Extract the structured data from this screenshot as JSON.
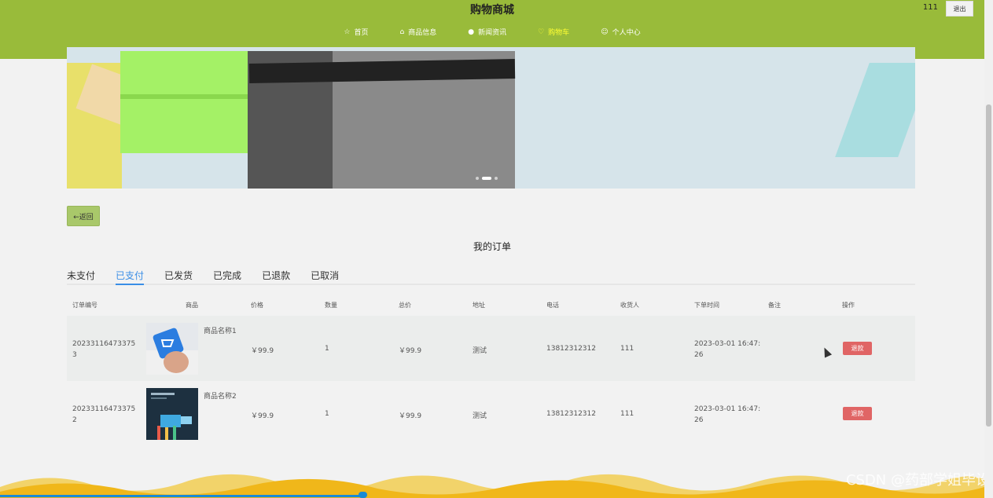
{
  "header": {
    "title": "购物商城",
    "username": "111",
    "logout_label": "退出",
    "nav": [
      {
        "icon": "star-icon",
        "label": "首页"
      },
      {
        "icon": "bag-icon",
        "label": "商品信息"
      },
      {
        "icon": "news-icon",
        "label": "新闻资讯"
      },
      {
        "icon": "heart-icon",
        "label": "购物车"
      },
      {
        "icon": "user-icon",
        "label": "个人中心"
      }
    ],
    "colors": {
      "header_bg": "#99bb3a",
      "active_nav": "#ffff33"
    }
  },
  "back_label": "←返回",
  "page_title": "我的订单",
  "tabs": [
    "未支付",
    "已支付",
    "已发货",
    "已完成",
    "已退款",
    "已取消"
  ],
  "active_tab": "已支付",
  "table": {
    "headers": [
      "订单编号",
      "商品",
      "价格",
      "数量",
      "总价",
      "地址",
      "电话",
      "收货人",
      "下单时间",
      "备注",
      "操作"
    ],
    "rows": [
      {
        "order_no_line1": "20233116473375",
        "order_no_line2": "3",
        "product_name": "商品名称1",
        "price": "￥99.9",
        "quantity": "1",
        "total": "￥99.9",
        "address": "测试",
        "phone": "13812312312",
        "receiver": "111",
        "time_line1": "2023-03-01 16:47:",
        "time_line2": "26",
        "note": "",
        "action": "退款"
      },
      {
        "order_no_line1": "20233116473375",
        "order_no_line2": "2",
        "product_name": "商品名称2",
        "price": "￥99.9",
        "quantity": "1",
        "total": "￥99.9",
        "address": "测试",
        "phone": "13812312312",
        "receiver": "111",
        "time_line1": "2023-03-01 16:47:",
        "time_line2": "26",
        "note": "",
        "action": "退款"
      }
    ]
  },
  "watermark": "CSDN @药部学姐毕设"
}
